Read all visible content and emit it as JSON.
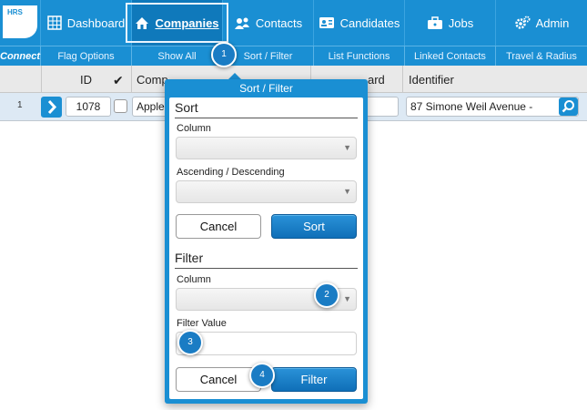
{
  "brand": {
    "logo_text": "HRS",
    "subnav_label": "Connect"
  },
  "nav": {
    "tabs": [
      {
        "label": "Dashboard",
        "icon": "grid-icon"
      },
      {
        "label": "Companies",
        "icon": "home-icon",
        "active": true
      },
      {
        "label": "Contacts",
        "icon": "people-icon"
      },
      {
        "label": "Candidates",
        "icon": "id-card-icon"
      },
      {
        "label": "Jobs",
        "icon": "briefcase-icon"
      },
      {
        "label": "Admin",
        "icon": "gear-icon"
      }
    ]
  },
  "subnav": {
    "items": [
      "Flag Options",
      "Show All",
      "Sort / Filter",
      "List Functions",
      "Linked Contacts",
      "Travel & Radius"
    ]
  },
  "table": {
    "columns": {
      "id": "ID",
      "company": "Comp",
      "board": "ard",
      "identifier": "Identifier"
    },
    "rows": [
      {
        "num": "1",
        "id": "1078",
        "company": "Apple",
        "identifier": "87 Simone Weil Avenue -"
      }
    ]
  },
  "popover": {
    "title": "Sort / Filter",
    "sort": {
      "heading": "Sort",
      "column_label": "Column",
      "column_value": "",
      "order_label": "Ascending / Descending",
      "order_value": "",
      "cancel_label": "Cancel",
      "submit_label": "Sort"
    },
    "filter": {
      "heading": "Filter",
      "column_label": "Column",
      "column_value": "",
      "value_label": "Filter Value",
      "value_value": "",
      "cancel_label": "Cancel",
      "submit_label": "Filter"
    }
  },
  "markers": [
    "1",
    "2",
    "3",
    "4"
  ],
  "colors": {
    "primary": "#1a8fd3",
    "active_tab": "#0f79bb",
    "button_primary": "#1b7fc8"
  }
}
